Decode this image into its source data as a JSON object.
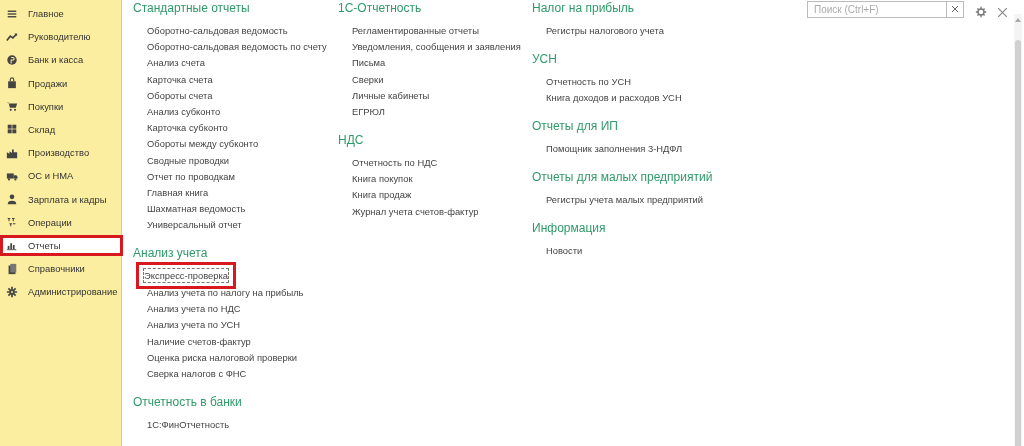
{
  "sidebar": {
    "items": [
      {
        "label": "Главное",
        "selected": false
      },
      {
        "label": "Руководителю",
        "selected": false
      },
      {
        "label": "Банк и касса",
        "selected": false
      },
      {
        "label": "Продажи",
        "selected": false
      },
      {
        "label": "Покупки",
        "selected": false
      },
      {
        "label": "Склад",
        "selected": false
      },
      {
        "label": "Производство",
        "selected": false
      },
      {
        "label": "ОС и НМА",
        "selected": false
      },
      {
        "label": "Зарплата и кадры",
        "selected": false
      },
      {
        "label": "Операции",
        "selected": false
      },
      {
        "label": "Отчеты",
        "selected": true,
        "highlighted": true
      },
      {
        "label": "Справочники",
        "selected": false
      },
      {
        "label": "Администрирование",
        "selected": false
      }
    ]
  },
  "search": {
    "placeholder": "Поиск (Ctrl+F)"
  },
  "columns": [
    {
      "sections": [
        {
          "title": "Стандартные отчеты",
          "items": [
            {
              "label": "Оборотно-сальдовая ведомость"
            },
            {
              "label": "Оборотно-сальдовая ведомость по счету"
            },
            {
              "label": "Анализ счета"
            },
            {
              "label": "Карточка счета"
            },
            {
              "label": "Обороты счета"
            },
            {
              "label": "Анализ субконто"
            },
            {
              "label": "Карточка субконто"
            },
            {
              "label": "Обороты между субконто"
            },
            {
              "label": "Сводные проводки"
            },
            {
              "label": "Отчет по проводкам"
            },
            {
              "label": "Главная книга"
            },
            {
              "label": "Шахматная ведомость"
            },
            {
              "label": "Универсальный отчет"
            }
          ]
        },
        {
          "title": "Анализ учета",
          "items": [
            {
              "label": "Экспресс-проверка",
              "focused": true,
              "highlighted": true
            },
            {
              "label": "Анализ учета по налогу на прибыль"
            },
            {
              "label": "Анализ учета по НДС"
            },
            {
              "label": "Анализ учета по УСН"
            },
            {
              "label": "Наличие счетов-фактур"
            },
            {
              "label": "Оценка риска налоговой проверки"
            },
            {
              "label": "Сверка налогов с ФНС"
            }
          ]
        },
        {
          "title": "Отчетность в банки",
          "items": [
            {
              "label": "1С:ФинОтчетность"
            }
          ]
        }
      ]
    },
    {
      "sections": [
        {
          "title": "1С-Отчетность",
          "items": [
            {
              "label": "Регламентированные отчеты"
            },
            {
              "label": "Уведомления, сообщения и заявления"
            },
            {
              "label": "Письма"
            },
            {
              "label": "Сверки"
            },
            {
              "label": "Личные кабинеты"
            },
            {
              "label": "ЕГРЮЛ"
            }
          ]
        },
        {
          "title": "НДС",
          "items": [
            {
              "label": "Отчетность по НДС"
            },
            {
              "label": "Книга покупок"
            },
            {
              "label": "Книга продаж"
            },
            {
              "label": "Журнал учета счетов-фактур"
            }
          ]
        }
      ]
    },
    {
      "sections": [
        {
          "title": "Налог на прибыль",
          "items": [
            {
              "label": "Регистры налогового учета"
            }
          ]
        },
        {
          "title": "УСН",
          "items": [
            {
              "label": "Отчетность по УСН"
            },
            {
              "label": "Книга доходов и расходов УСН"
            }
          ]
        },
        {
          "title": "Отчеты для ИП",
          "items": [
            {
              "label": "Помощник заполнения 3-НДФЛ"
            }
          ]
        },
        {
          "title": "Отчеты для малых предприятий",
          "items": [
            {
              "label": "Регистры учета малых предприятий"
            }
          ]
        },
        {
          "title": "Информация",
          "items": [
            {
              "label": "Новости"
            }
          ]
        }
      ]
    }
  ]
}
